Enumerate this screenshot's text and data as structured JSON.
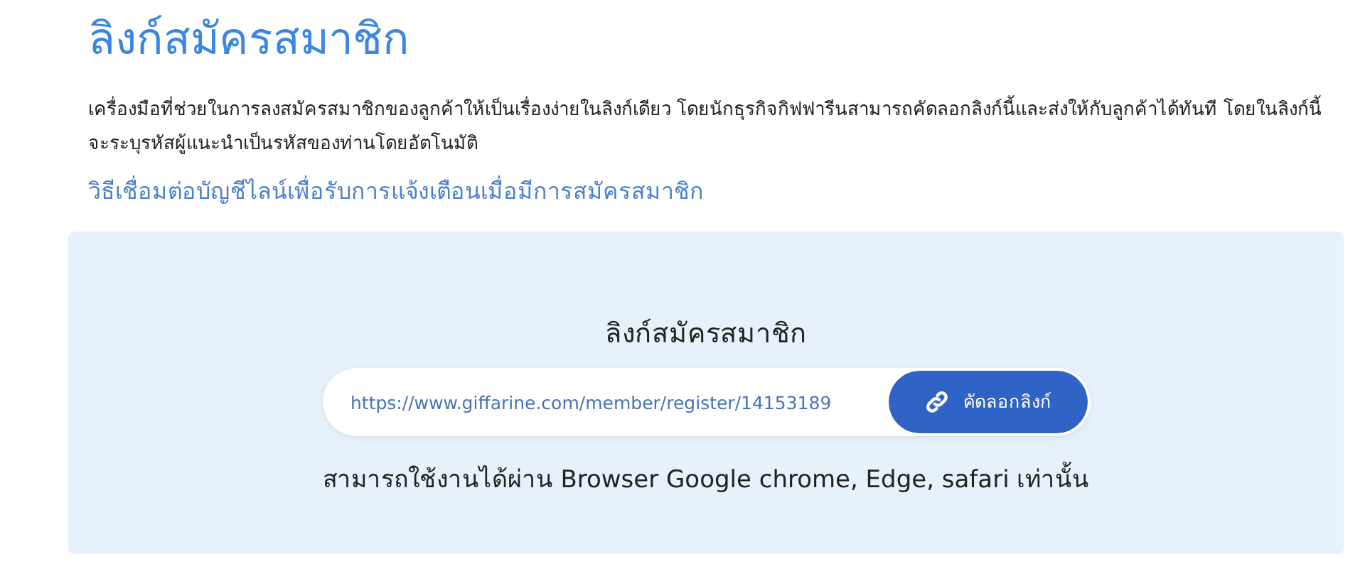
{
  "page_title": "ลิงก์สมัครสมาชิก",
  "description": "เครื่องมือที่ช่วยในการลงสมัครสมาชิกของลูกค้าให้เป็นเรื่องง่ายในลิงก์เดียว โดยนักธุรกิจกิฟฟารีนสามารถคัดลอกลิงก์นี้และส่งให้กับลูกค้าได้ทันที โดยในลิงก์นี้จะระบุรหัสผู้แนะนำเป็นรหัสของท่านโดยอัตโนมัติ",
  "line_link": "วิธีเชื่อมต่อบัญชีไลน์เพื่อรับการแจ้งเตือนเมื่อมีการสมัครสมาชิก",
  "panel": {
    "heading": "ลิงก์สมัครสมาชิก",
    "url": "https://www.giffarine.com/member/register/14153189",
    "copy_button": "คัดลอกลิงก์",
    "note": "สามารถใช้งานได้ผ่าน Browser Google chrome, Edge, safari เท่านั้น"
  }
}
